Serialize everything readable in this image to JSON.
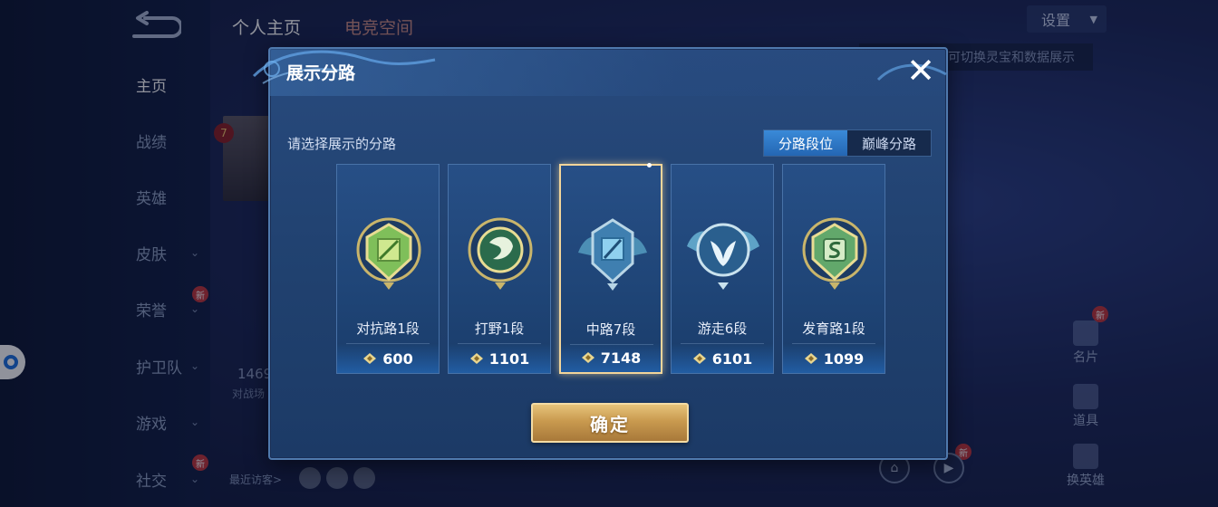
{
  "background": {
    "top_tabs": [
      "个人主页",
      "电竞空间"
    ],
    "settings_label": "设置",
    "hint_text": "可切换灵宝和数据展示",
    "sidebar": [
      {
        "label": "主页",
        "active": true
      },
      {
        "label": "战绩"
      },
      {
        "label": "英雄"
      },
      {
        "label": "皮肤",
        "has_chevron": true
      },
      {
        "label": "荣誉",
        "has_chevron": true,
        "badge": "新"
      },
      {
        "label": "护卫队",
        "has_chevron": true
      },
      {
        "label": "游戏",
        "has_chevron": true
      },
      {
        "label": "社交",
        "has_chevron": true,
        "badge": "新"
      }
    ],
    "level": "7",
    "battle_count": "1469",
    "battle_sub": "对战场",
    "recent_visitors": "最近访客>",
    "right_features": [
      "名片",
      "道具",
      "换英雄"
    ],
    "new_badge": "新"
  },
  "modal": {
    "title": "展示分路",
    "close_icon": "close-icon",
    "prompt": "请选择展示的分路",
    "segments": [
      {
        "label": "分路段位",
        "active": true
      },
      {
        "label": "巅峰分路",
        "active": false
      }
    ],
    "lanes": [
      {
        "name": "对抗路1段",
        "score": "600",
        "selected": false,
        "emblem": "sword-shield-emblem"
      },
      {
        "name": "打野1段",
        "score": "1101",
        "selected": false,
        "emblem": "dragon-emblem"
      },
      {
        "name": "中路7段",
        "score": "7148",
        "selected": true,
        "emblem": "staff-emblem"
      },
      {
        "name": "游走6段",
        "score": "6101",
        "selected": false,
        "emblem": "wings-emblem"
      },
      {
        "name": "发育路1段",
        "score": "1099",
        "selected": false,
        "emblem": "coin-emblem"
      }
    ],
    "confirm_label": "确定"
  },
  "colors": {
    "modal_bg": "#20416f",
    "accent_blue": "#2466b3",
    "gold": "#c99a4f",
    "selected_border": "#f2d59a"
  }
}
